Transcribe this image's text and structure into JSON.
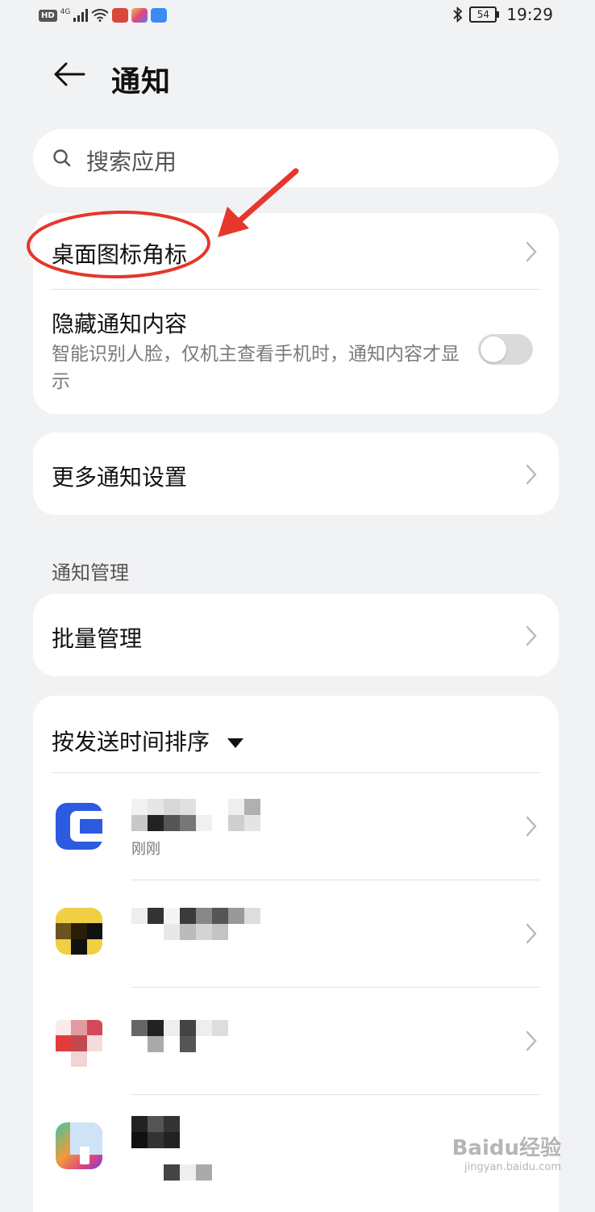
{
  "status_bar": {
    "hd": "HD",
    "network": "4G",
    "time": "19:29",
    "battery": "54"
  },
  "header": {
    "title": "通知"
  },
  "search": {
    "placeholder": "搜索应用"
  },
  "card1": {
    "badge_label": "桌面图标角标",
    "hide_title": "隐藏通知内容",
    "hide_desc": "智能识别人脸，仅机主查看手机时，通知内容才显示",
    "hide_enabled": false
  },
  "card2": {
    "more_label": "更多通知设置"
  },
  "management": {
    "section_label": "通知管理",
    "batch_label": "批量管理",
    "sort_label": "按发送时间排序"
  },
  "apps": [
    {
      "sub": "刚刚",
      "icon": "app-blue-icon"
    },
    {
      "sub": "",
      "icon": "app-yellow-icon"
    },
    {
      "sub": "",
      "icon": "app-red-icon"
    },
    {
      "sub": "",
      "icon": "app-gradient-icon"
    }
  ],
  "watermark": {
    "brand": "Baidu经验",
    "url": "jingyan.baidu.com"
  },
  "colors": {
    "background": "#f1f2f4",
    "card": "#ffffff",
    "annotation_red": "#e5372b",
    "toggle_off": "#dadada"
  }
}
